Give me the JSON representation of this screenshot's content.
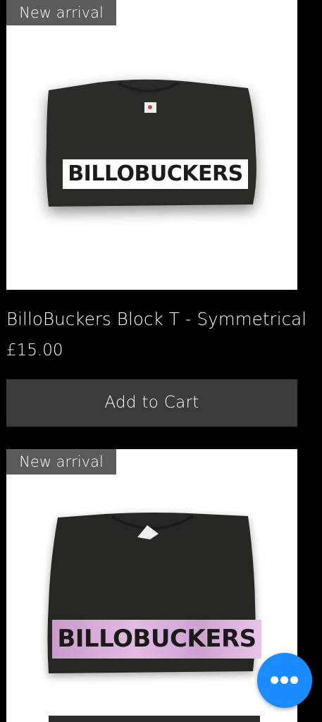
{
  "products": [
    {
      "badge": "New arrival",
      "image_text": "BILLOBUCKERS",
      "title": "BilloBuckers Block T - Symmetrical",
      "price": "£15.00",
      "cta": "Add to Cart"
    },
    {
      "badge": "New arrival",
      "image_text": "BILLOBUCKERS"
    }
  ],
  "chat": {
    "icon": "more-dots-icon"
  },
  "colors": {
    "background": "#000000",
    "badge": "#5b5b5b",
    "button": "#3b3b3b",
    "chat": "#1a8cff",
    "pink_foil": "#d6a6d8"
  }
}
